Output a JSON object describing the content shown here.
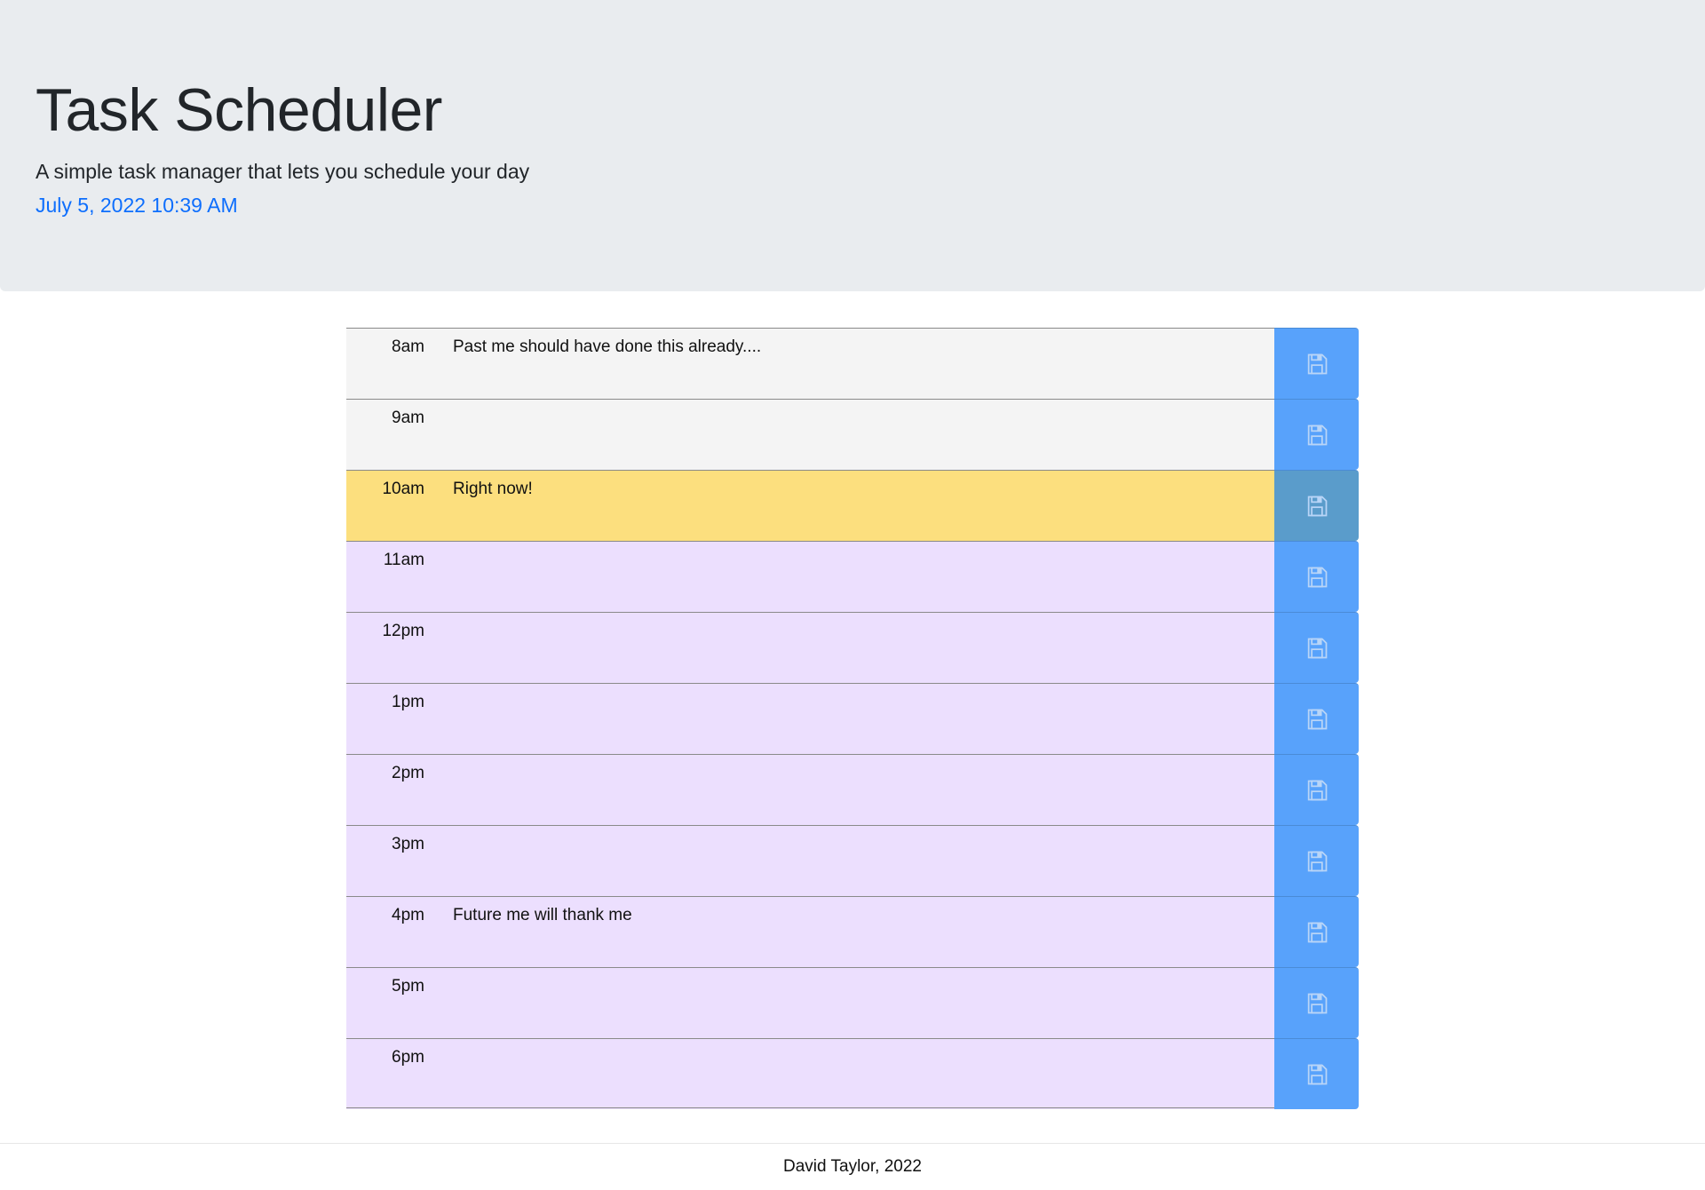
{
  "header": {
    "title": "Task Scheduler",
    "subtitle": "A simple task manager that lets you schedule your day",
    "datetime": "July 5, 2022 10:39 AM"
  },
  "colors": {
    "past": "#f4f4f4",
    "present": "#fcdf7e",
    "future": "#ecdffe",
    "save_button": "#58a2fb",
    "save_button_present": "#5a9ccb",
    "datetime_link": "#0d6efd"
  },
  "save_icon": "floppy-disk-icon",
  "schedule": [
    {
      "hour": "8am",
      "task": "Past me should have done this already....",
      "state": "past"
    },
    {
      "hour": "9am",
      "task": "",
      "state": "past"
    },
    {
      "hour": "10am",
      "task": "Right now!",
      "state": "present"
    },
    {
      "hour": "11am",
      "task": "",
      "state": "future"
    },
    {
      "hour": "12pm",
      "task": "",
      "state": "future"
    },
    {
      "hour": "1pm",
      "task": "",
      "state": "future"
    },
    {
      "hour": "2pm",
      "task": "",
      "state": "future"
    },
    {
      "hour": "3pm",
      "task": "",
      "state": "future"
    },
    {
      "hour": "4pm",
      "task": "Future me will thank me",
      "state": "future"
    },
    {
      "hour": "5pm",
      "task": "",
      "state": "future"
    },
    {
      "hour": "6pm",
      "task": "",
      "state": "future"
    }
  ],
  "footer": {
    "text": "David Taylor, 2022"
  }
}
